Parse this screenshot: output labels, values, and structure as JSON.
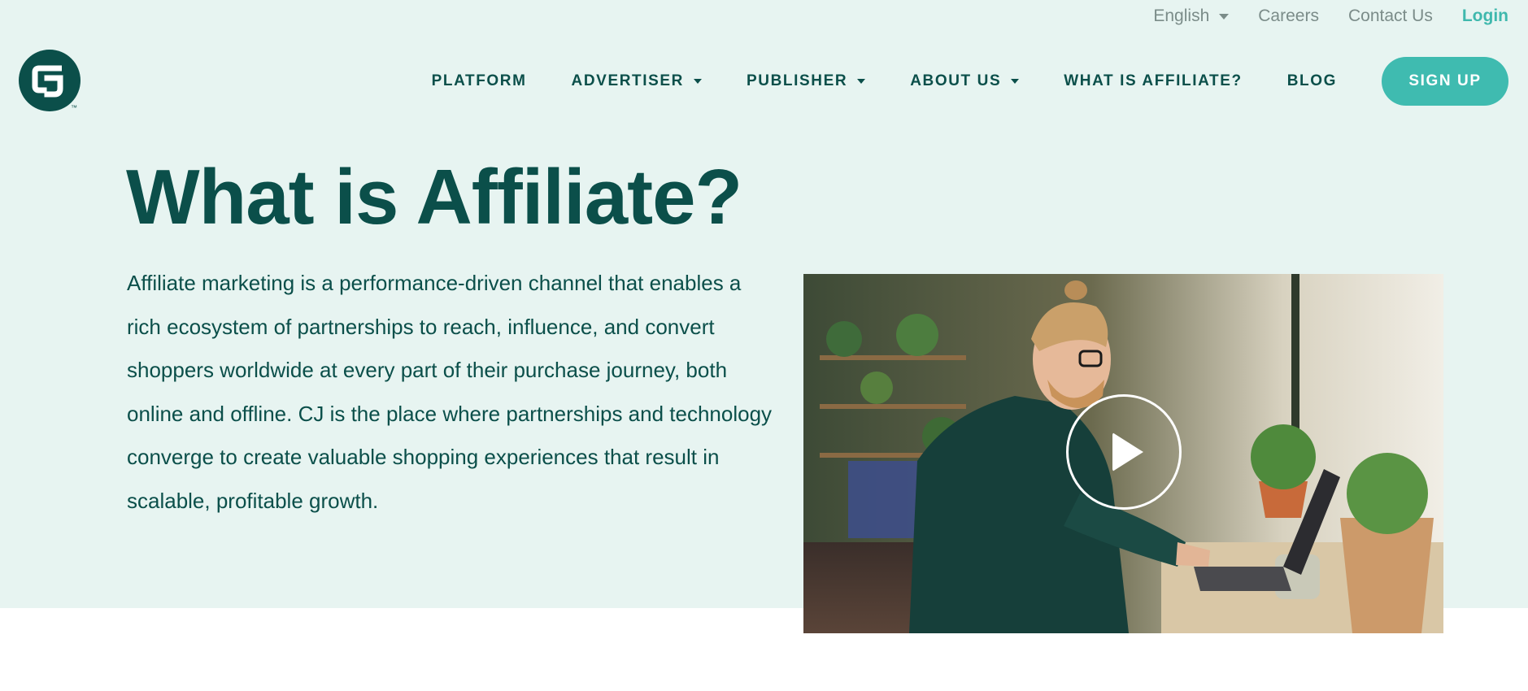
{
  "utility": {
    "language": "English",
    "careers": "Careers",
    "contact": "Contact Us",
    "login": "Login"
  },
  "logo": {
    "tm": "™"
  },
  "nav": {
    "items": [
      {
        "label": "PLATFORM",
        "dropdown": false
      },
      {
        "label": "ADVERTISER",
        "dropdown": true
      },
      {
        "label": "PUBLISHER",
        "dropdown": true
      },
      {
        "label": "ABOUT US",
        "dropdown": true
      },
      {
        "label": "WHAT IS AFFILIATE?",
        "dropdown": false
      },
      {
        "label": "BLOG",
        "dropdown": false
      }
    ],
    "signup": "SIGN UP"
  },
  "hero": {
    "title": "What is Affiliate?",
    "description": "Affiliate marketing is a performance-driven channel that enables a rich ecosystem of partnerships to reach, influence, and convert shoppers worldwide at every part of their purchase journey, both online and offline. CJ is the place where partnerships and technology converge to create valuable shopping experiences that result in scalable, profitable growth."
  },
  "colors": {
    "brand_dark": "#0b4f4a",
    "accent": "#3fbbb0",
    "hero_bg": "#e7f4f1"
  },
  "icons": {
    "logo": "cj-logo-icon",
    "play": "play-icon",
    "caret": "caret-down-icon"
  }
}
